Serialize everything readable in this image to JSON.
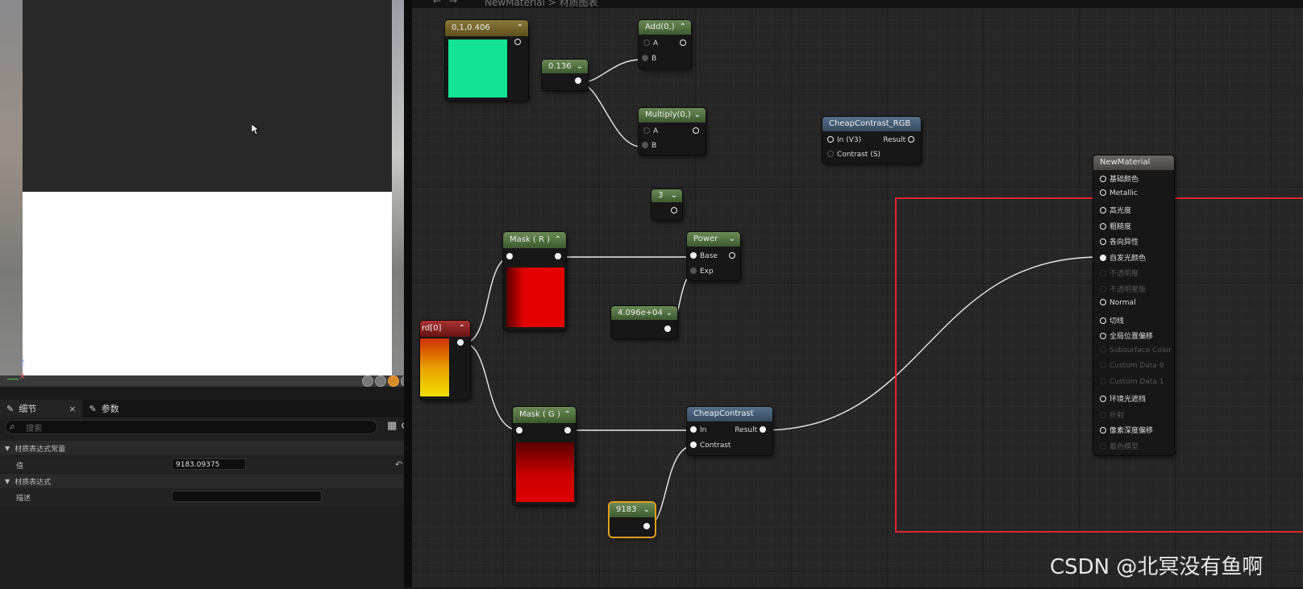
{
  "viewport": {
    "axis_z": "Z",
    "axis_x": "X"
  },
  "details": {
    "tabs": [
      {
        "label": "细节",
        "close": "×"
      },
      {
        "label": "参数"
      }
    ],
    "search_placeholder": "搜索",
    "categories": [
      {
        "label": "材质表达式常量"
      },
      {
        "label": "材质表达式"
      }
    ],
    "props": [
      {
        "label": "值",
        "value": "9183.09375"
      },
      {
        "label": "描述",
        "value": ""
      }
    ]
  },
  "graph": {
    "breadcrumb": "NewMaterial > 材质图表",
    "nodes": {
      "vec_const": {
        "title": "0,1,0.406",
        "color": "#12e394"
      },
      "c_0136": {
        "title": "0.136"
      },
      "add": {
        "title": "Add(0,)",
        "pin_a": "A",
        "pin_b": "B"
      },
      "multiply": {
        "title": "Multiply(0,)",
        "pin_a": "A",
        "pin_b": "B"
      },
      "cheap_rgb": {
        "title": "CheapContrast_RGB",
        "pin_in": "In (V3)",
        "pin_result": "Result",
        "pin_contrast": "Contrast (S)"
      },
      "c_3": {
        "title": "3"
      },
      "mask_r": {
        "title": "Mask ( R )"
      },
      "power": {
        "title": "Power",
        "pin_base": "Base",
        "pin_exp": "Exp"
      },
      "c_4096": {
        "title": "4.096e+04"
      },
      "texcoord": {
        "title": "rd[0]"
      },
      "mask_g": {
        "title": "Mask ( G )"
      },
      "cheap": {
        "title": "CheapContrast",
        "pin_in": "In",
        "pin_result": "Result",
        "pin_contrast": "Contrast"
      },
      "c_9183": {
        "title": "9183"
      },
      "material": {
        "title": "NewMaterial",
        "pins": [
          {
            "label": "基础颜色",
            "enabled": true
          },
          {
            "label": "Metallic",
            "enabled": true
          },
          {
            "label": "高光度",
            "enabled": true
          },
          {
            "label": "粗糙度",
            "enabled": true
          },
          {
            "label": "各向异性",
            "enabled": true
          },
          {
            "label": "自发光颜色",
            "enabled": true
          },
          {
            "label": "不透明度",
            "enabled": false
          },
          {
            "label": "不透明蒙版",
            "enabled": false
          },
          {
            "label": "Normal",
            "enabled": true
          },
          {
            "label": "切线",
            "enabled": true
          },
          {
            "label": "全局位置偏移",
            "enabled": true
          },
          {
            "label": "Subsurface Color",
            "enabled": false
          },
          {
            "label": "Custom Data 0",
            "enabled": false
          },
          {
            "label": "Custom Data 1",
            "enabled": false
          },
          {
            "label": "环境光遮挡",
            "enabled": true
          },
          {
            "label": "折射",
            "enabled": false
          },
          {
            "label": "像素深度偏移",
            "enabled": true
          },
          {
            "label": "着色模型",
            "enabled": false
          }
        ]
      }
    }
  },
  "watermark": "CSDN @北冥没有鱼啊"
}
